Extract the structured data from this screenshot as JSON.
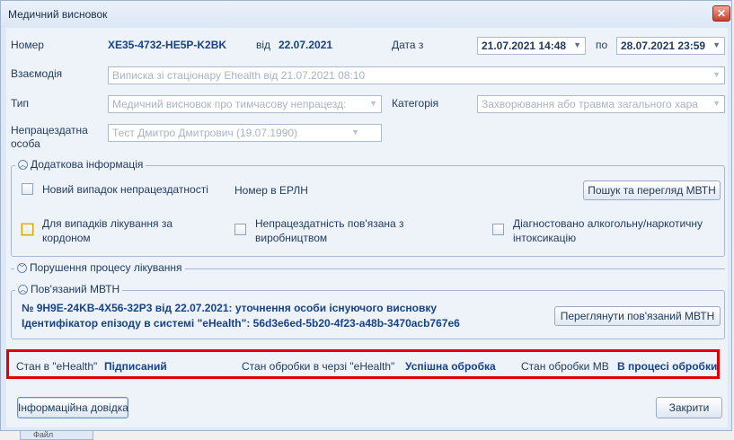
{
  "window": {
    "title": "Медичний висновок",
    "close_icon": "✕"
  },
  "header": {
    "number_label": "Номер",
    "number_value": "XE35-4732-HE5P-K2BK",
    "from_label": "від",
    "from_value": "22.07.2021",
    "date_from_label": "Дата з",
    "date_from_value": "21.07.2021 14:48",
    "date_to_label": "по",
    "date_to_value": "28.07.2021 23:59"
  },
  "fields": {
    "interaction_label": "Взаємодія",
    "interaction_value": "Виписка зі стаціонару Ehealth від 21.07.2021 08:10",
    "type_label": "Тип",
    "type_value": "Медичний висновок про тимчасову непрацезд:",
    "category_label": "Категорія",
    "category_value": "Захворювання або травма загального хара",
    "person_label": "Непрацездатна особа",
    "person_value": "Тест Дмитро Дмитрович (19.07.1990)"
  },
  "additional": {
    "title": "Додаткова інформація",
    "new_case_label": "Новий випадок непрацездатності",
    "erln_label": "Номер в ЕРЛН",
    "search_button": "Пошук та перегляд МВТН",
    "abroad_label": "Для випадків лікування за кордоном",
    "production_label": "Непрацездатність пов'язана з виробництвом",
    "alcohol_label": "Діагностовано алкогольну/наркотичну інтоксикацію"
  },
  "violation": {
    "title": "Порушення процесу лікування"
  },
  "related": {
    "title": "Пов'язаний МВТН",
    "line1": "№ 9H9E-24KB-4X56-32P3 від 22.07.2021: уточнення особи існуючого висновку",
    "line2": "Ідентифікатор епізоду в системі \"eHealth\": 56d3e6ed-5b20-4f23-a48b-3470acb767e6",
    "view_button": "Переглянути пов'язаний МВТН"
  },
  "status": {
    "ehealth_label": "Стан в \"eHealth\"",
    "ehealth_value": "Підписаний",
    "queue_label": "Стан обробки в черзі \"eHealth\"",
    "queue_value": "Успішна обробка",
    "mv_label": "Стан обробки МВ",
    "mv_value": "В процесі обробки"
  },
  "footer": {
    "info_button": "Інформаційна довідка",
    "close_button": "Закрити"
  },
  "background_fragment": "Файл"
}
